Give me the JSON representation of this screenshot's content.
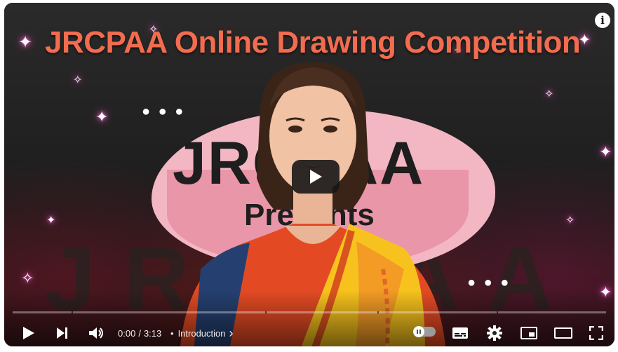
{
  "video": {
    "headline": "JRCPAA Online Drawing Competition",
    "brand_text": "JRCPAA",
    "presents_text": "Presents",
    "watermark_text": "JRCPAA"
  },
  "player": {
    "info_label": "i",
    "current_time": "0:00",
    "duration": "3:13",
    "time_separator": "/",
    "chapter_bullet": "•",
    "chapter_title": "Introduction",
    "chapter_chevron": "›",
    "progress_fraction": 0.0
  },
  "icons": {
    "play": "play-icon",
    "next": "skip-next-icon",
    "volume": "volume-icon",
    "autoplay": "autoplay-toggle-icon",
    "subtitles": "subtitles-icon",
    "settings": "gear-icon",
    "miniplayer": "miniplayer-icon",
    "theater": "theater-mode-icon",
    "fullscreen": "fullscreen-icon",
    "big_play": "big-play-icon",
    "info": "info-icon"
  },
  "colors": {
    "headline": "#f26c4f",
    "play_button_bg": "#171717",
    "blob": "#f3b7c4"
  }
}
